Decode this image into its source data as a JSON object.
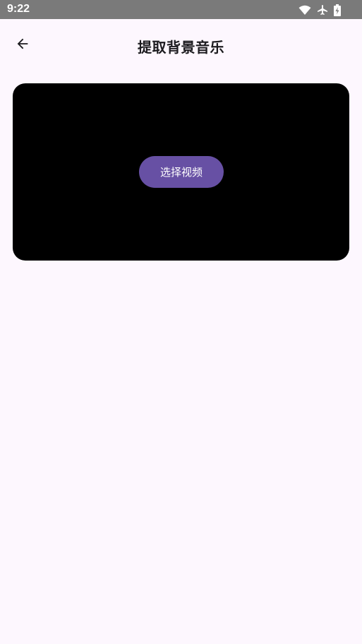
{
  "status_bar": {
    "time": "9:22",
    "icons": [
      "wifi-icon",
      "airplane-icon",
      "battery-charging-icon"
    ],
    "background": "#7a7a7a"
  },
  "app_bar": {
    "title": "提取背景音乐",
    "back_icon": "arrow-left-icon"
  },
  "video_panel": {
    "select_button_label": "选择视频",
    "background": "#000000",
    "button_color": "#6750a4"
  },
  "page": {
    "background": "#fdf7fe"
  }
}
